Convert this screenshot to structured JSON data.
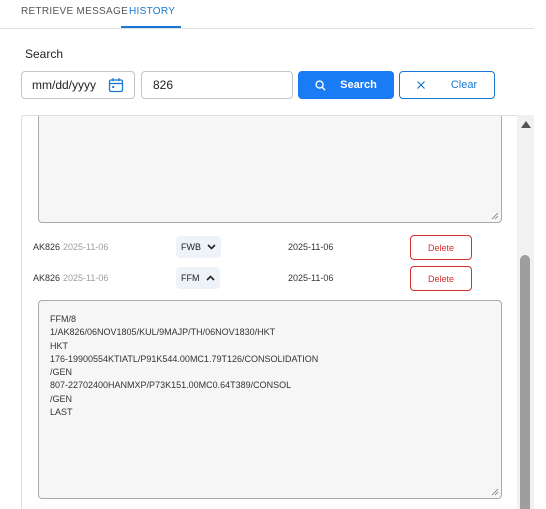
{
  "tabs": [
    {
      "label": "RETRIEVE MESSAGE"
    },
    {
      "label": "HISTORY"
    }
  ],
  "search": {
    "label": "Search",
    "date_placeholder": "mm/dd/yyyy",
    "query_value": "826",
    "search_button": "Search",
    "clear_button": "Clear"
  },
  "rows": [
    {
      "code": "AK826",
      "date": "2025-11-06",
      "type": "FWB",
      "chevron": "chevron-down-icon",
      "message_date": "2025-11-06",
      "delete_label": "Delete"
    },
    {
      "code": "AK826",
      "date": "2025-11-06",
      "type": "FFM",
      "chevron": "chevron-up-icon",
      "message_date": "2025-11-06",
      "delete_label": "Delete"
    }
  ],
  "message_text": "FFM/8\n1/AK826/06NOV1805/KUL/9MAJP/TH/06NOV1830/HKT\nHKT\n176-19900554KTIATL/P91K544.00MC1.79T126/CONSOLIDATION\n/GEN\n807-22702400HANMXP/P73K151.00MC0.64T389/CONSOL\n/GEN\nLAST",
  "colors": {
    "accent": "#1976d2",
    "search_button": "#1a7cf5",
    "danger": "#d32f2f",
    "chip_bg": "#eef3fa"
  }
}
